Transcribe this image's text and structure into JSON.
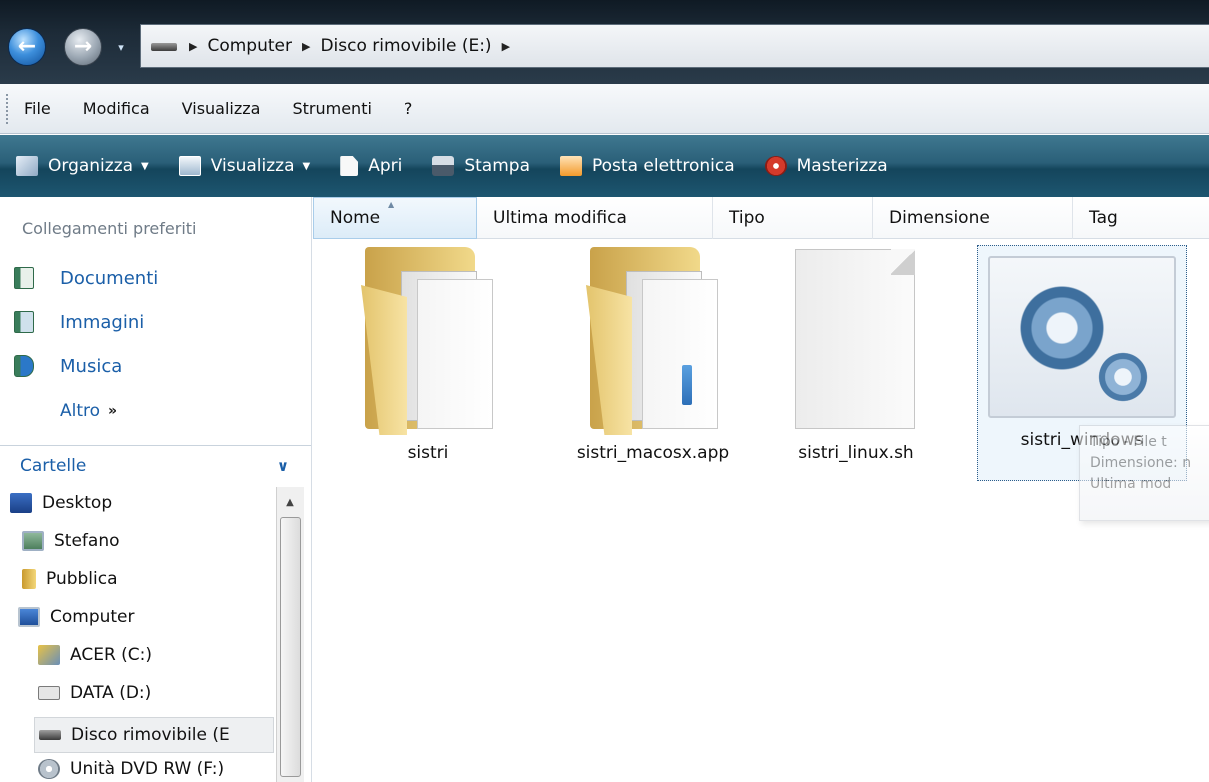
{
  "address_bar": {
    "breadcrumbs": [
      "Computer",
      "Disco rimovibile (E:)"
    ],
    "drive_icon": "removable-drive-icon",
    "back_icon": "back-arrow-icon",
    "forward_icon": "forward-arrow-icon"
  },
  "menu": {
    "items": [
      "File",
      "Modifica",
      "Visualizza",
      "Strumenti",
      "?"
    ]
  },
  "toolbar": {
    "organize": "Organizza",
    "views": "Visualizza",
    "open": "Apri",
    "print": "Stampa",
    "email": "Posta elettronica",
    "burn": "Masterizza"
  },
  "nav": {
    "favorites_heading": "Collegamenti preferiti",
    "favorites": [
      "Documenti",
      "Immagini",
      "Musica"
    ],
    "more": "Altro",
    "folders_heading": "Cartelle",
    "tree": [
      "Desktop",
      "Stefano",
      "Pubblica",
      "Computer",
      "ACER (C:)",
      "DATA (D:)",
      "Disco rimovibile (E",
      "Unità DVD RW (F:)"
    ]
  },
  "columns": [
    "Nome",
    "Ultima modifica",
    "Tipo",
    "Dimensione",
    "Tag"
  ],
  "files": [
    {
      "name": "sistri",
      "icon": "folder-icon"
    },
    {
      "name": "sistri_macosx.app",
      "icon": "folder-icon"
    },
    {
      "name": "sistri_linux.sh",
      "icon": "file-icon"
    },
    {
      "name": "sistri_windows",
      "icon": "application-gear-icon"
    }
  ],
  "tooltip": {
    "line1": "Tipo - File t",
    "line2": "Dimensione: n",
    "line3": "Ultima mod"
  },
  "colors": {
    "command_bar": "#1d5670",
    "link": "#1b5fa8",
    "selection": "#eef6fc"
  }
}
